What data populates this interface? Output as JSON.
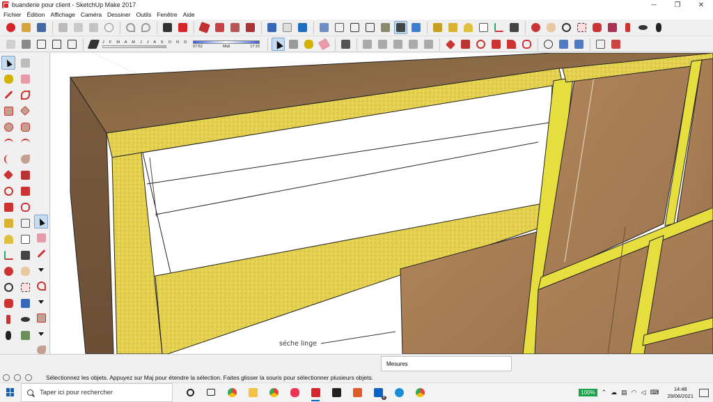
{
  "window": {
    "title": "buanderie pour client - SketchUp Make 2017",
    "minimize": "─",
    "restore": "❐",
    "close": "✕"
  },
  "menu": [
    "Fichier",
    "Édition",
    "Affichage",
    "Caméra",
    "Dessiner",
    "Outils",
    "Fenêtre",
    "Aide"
  ],
  "shadows": {
    "months": "J F M A M J J A S O N D",
    "time_start": "07:52",
    "time_mid": "Midi",
    "time_end": "17:15"
  },
  "viewport": {
    "annotation": "séche linge"
  },
  "status": {
    "measures_label": "Mesures",
    "hint": "Sélectionnez les objets. Appuyez sur Maj pour étendre la sélection. Faites glisser la souris pour sélectionner plusieurs objets."
  },
  "taskbar": {
    "search_placeholder": "Taper ici pour rechercher",
    "battery": "100%",
    "time": "14:48",
    "date": "29/06/2021",
    "mail_badge": "8"
  },
  "colors": {
    "wood_top": "#8a6a45",
    "chipboard": "#e3cf4a",
    "edge_yellow": "#e6dd3e",
    "panel_white": "#ffffff",
    "back_panel": "#b0865a",
    "accent_red": "#d6262b"
  }
}
